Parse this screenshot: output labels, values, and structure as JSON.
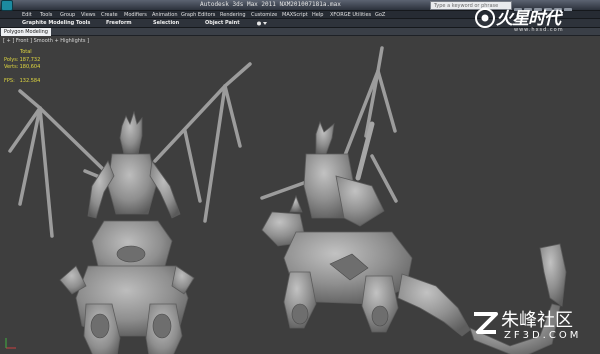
{
  "window": {
    "title": "Autodesk 3ds Max    2011       NXM201007181a.max",
    "search_placeholder": "Type a keyword or phrase"
  },
  "menu": [
    "Edit",
    "Tools",
    "Group",
    "Views",
    "Create",
    "Modifiers",
    "Animation",
    "Graph Editors",
    "Rendering",
    "Customize",
    "MAXScript",
    "Help",
    "XFORGE Utilities",
    "GoZ"
  ],
  "ribbon": {
    "tabs": [
      "Graphite Modeling Tools",
      "Freeform",
      "Selection",
      "Object Paint"
    ],
    "panel_tab": "Polygon Modeling"
  },
  "viewport": {
    "label": "[ + ] Front ] Smooth + Highlights ]",
    "stats": {
      "header": "Total",
      "polys_label": "Polys:",
      "polys": "187,732",
      "verts_label": "Verts:",
      "verts": "180,604",
      "fps_label": "FPS:",
      "fps": "132.584"
    }
  },
  "watermarks": {
    "top_brand": "火星时代",
    "top_url": "www.hxsd.com",
    "bottom_cn": "朱峰社区",
    "bottom_en": "ZF3D.COM"
  },
  "colors": {
    "viewport_bg": "#3e3e3e",
    "model": "#9a9a9a",
    "stats_text": "#e0d840"
  }
}
